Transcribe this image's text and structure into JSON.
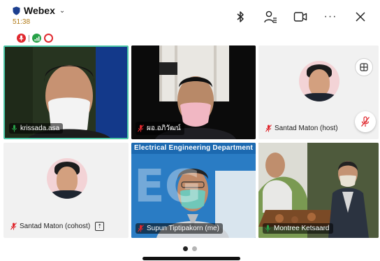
{
  "app": {
    "title": "Webex",
    "timer": "51:38"
  },
  "colors": {
    "accent_active_border": "#4cc7a7",
    "timer": "#b27a14",
    "muted": "#e0282e",
    "unmuted": "#27a148"
  },
  "status_icons": [
    "muted-status-icon",
    "signal-bars-icon",
    "recording-icon"
  ],
  "toolbar": {
    "bluetooth": "bluetooth-icon",
    "participants": "participants-icon",
    "camera_switch": "camera-switch-icon",
    "more": "···",
    "close": "✕"
  },
  "tiles": [
    {
      "name": "krissada.asa",
      "mic": "on",
      "active_speaker": true
    },
    {
      "name": "ผอ.อภิวัฒน์",
      "mic": "muted"
    },
    {
      "name": "Santad Maton (host)",
      "mic": "muted",
      "avatar": true
    },
    {
      "name": "Santad Maton (cohost)",
      "mic": "muted",
      "avatar": true,
      "upload_icon": "⇡"
    },
    {
      "name": "Supun Tiptipakorn (me)",
      "mic": "muted",
      "banner": "Electrical Engineering Department",
      "wall_text": "EG"
    },
    {
      "name": "Montree Ketsaard",
      "mic": "on"
    }
  ],
  "pager": {
    "pages": 2,
    "current": 1
  }
}
